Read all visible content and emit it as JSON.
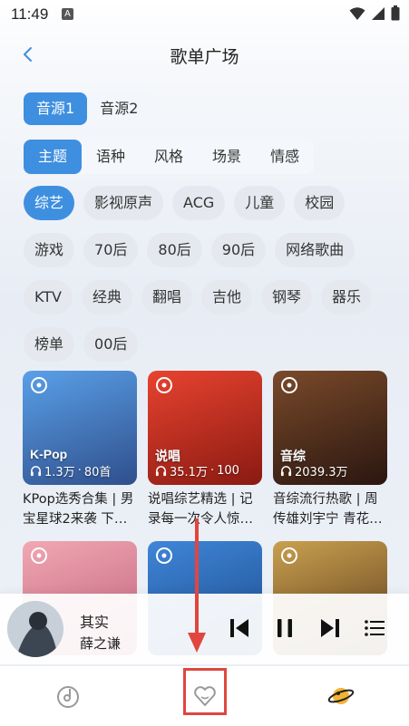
{
  "status_bar": {
    "time": "11:49",
    "notification_badge": "A"
  },
  "header": {
    "title": "歌单广场"
  },
  "sources": [
    {
      "label": "音源1",
      "active": true
    },
    {
      "label": "音源2",
      "active": false
    }
  ],
  "categories": [
    {
      "label": "主题",
      "active": true
    },
    {
      "label": "语种",
      "active": false
    },
    {
      "label": "风格",
      "active": false
    },
    {
      "label": "场景",
      "active": false
    },
    {
      "label": "情感",
      "active": false
    }
  ],
  "tags": [
    {
      "label": "综艺",
      "active": true
    },
    {
      "label": "影视原声"
    },
    {
      "label": "ACG"
    },
    {
      "label": "儿童"
    },
    {
      "label": "校园"
    },
    {
      "label": "游戏"
    },
    {
      "label": "70后"
    },
    {
      "label": "80后"
    },
    {
      "label": "90后"
    },
    {
      "label": "网络歌曲"
    },
    {
      "label": "KTV"
    },
    {
      "label": "经典"
    },
    {
      "label": "翻唱"
    },
    {
      "label": "吉他"
    },
    {
      "label": "钢琴"
    },
    {
      "label": "器乐"
    },
    {
      "label": "榜单"
    },
    {
      "label": "00后"
    }
  ],
  "playlists": [
    {
      "cover_text": "K-Pop",
      "plays": "1.3万",
      "tracks": "80首",
      "title": "KPop选秀合集 | 男宝星球2来袭 下…",
      "color_top": "#5aa0e8",
      "color_bottom": "#2f4f8c"
    },
    {
      "cover_text": "说唱",
      "plays": "35.1万",
      "tracks": "100",
      "title": "说唱综艺精选 | 记录每一次令人惊…",
      "color_top": "#e8432f",
      "color_bottom": "#8a1a12"
    },
    {
      "cover_text": "音综",
      "plays": "2039.3万",
      "tracks": "",
      "title": "音综流行热歌 | 周传雄刘宇宁 青花…",
      "color_top": "#7a4a2a",
      "color_bottom": "#2a1610"
    },
    {
      "cover_text": "",
      "plays": "",
      "tracks": "",
      "title": "",
      "color_top": "#f0a8b4",
      "color_bottom": "#c06078"
    },
    {
      "cover_text": "",
      "plays": "",
      "tracks": "",
      "title": "",
      "color_top": "#3f86d8",
      "color_bottom": "#1c4a8a"
    },
    {
      "cover_text": "",
      "plays": "",
      "tracks": "",
      "title": "",
      "color_top": "#c9a050",
      "color_bottom": "#5a3a1a"
    }
  ],
  "player": {
    "title": "其实",
    "artist": "薛之谦"
  },
  "colors": {
    "accent": "#3f8fe0",
    "annotation": "#e0463f"
  }
}
